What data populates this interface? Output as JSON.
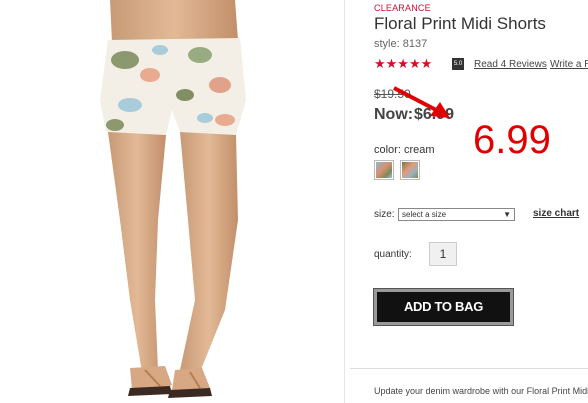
{
  "product": {
    "badge": "CLEARANCE",
    "title": "Floral Print Midi Shorts",
    "style": "style: 8137",
    "stars": "★★★★★",
    "rating": "5.0",
    "reviews_link": "Read 4 Reviews",
    "write_link": "Write a Review",
    "was_price": "$19.50",
    "now_label": "Now:",
    "now_price": "$6.99",
    "annotation_price": "6.99",
    "color_label": "color: cream",
    "size_label": "size:",
    "size_select": "select a size",
    "size_chart": "size chart",
    "quantity_label": "quantity:",
    "quantity": "1",
    "add_button": "ADD TO BAG",
    "description": "Update your denim wardrobe with our Floral Print Midi Shorts"
  },
  "colors": {
    "accent_red": "#c8102e",
    "annotation_red": "#e00000",
    "button_black": "#111111"
  },
  "icons": {
    "caret": "chevron-down-icon",
    "arrow": "annotation-arrow-icon"
  }
}
